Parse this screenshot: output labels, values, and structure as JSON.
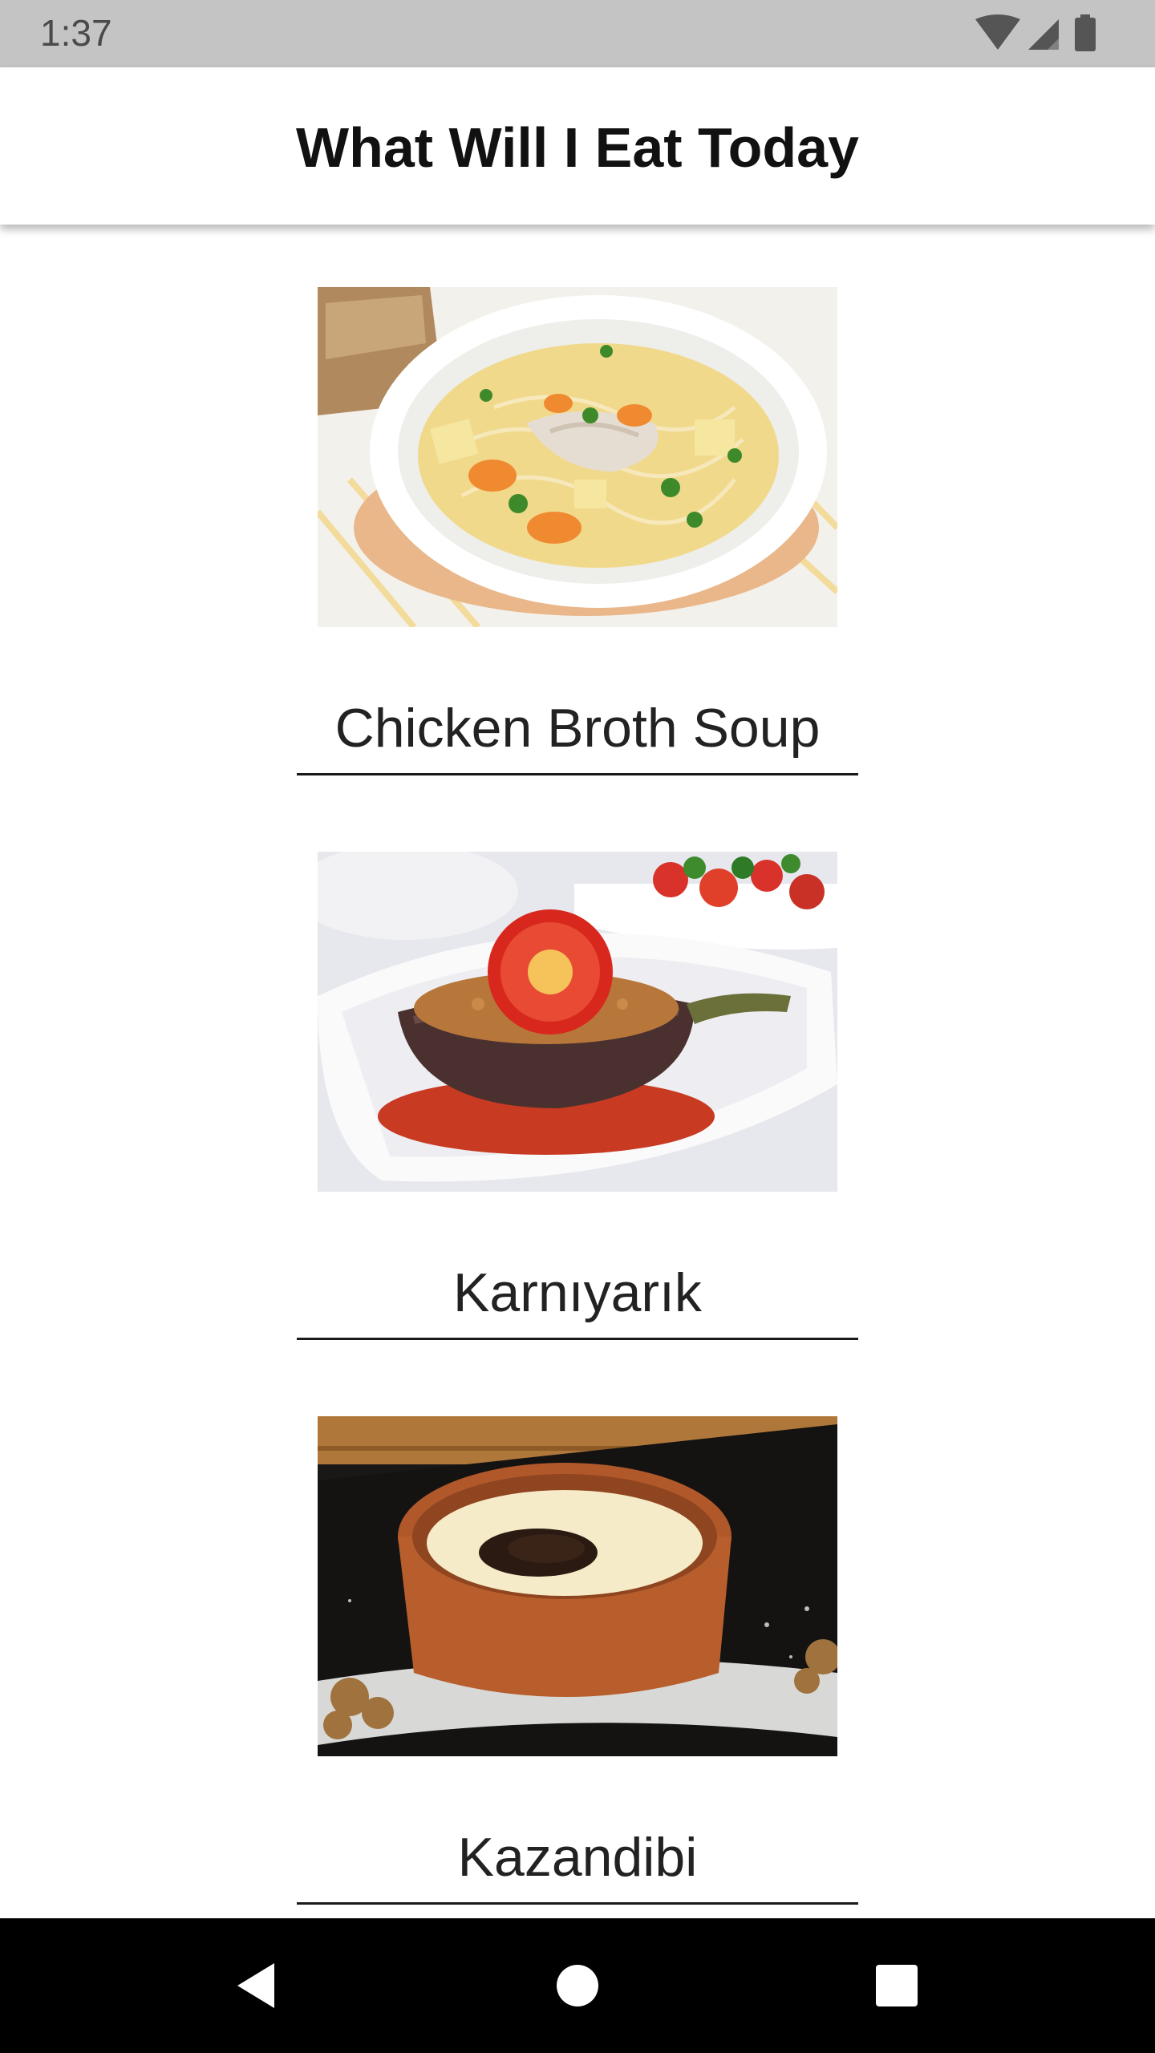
{
  "status_bar": {
    "time": "1:37",
    "icons": [
      "wifi-icon",
      "cell-signal-icon",
      "battery-icon"
    ]
  },
  "app_bar": {
    "title": "What Will I Eat Today"
  },
  "foods": [
    {
      "name": "Chicken Broth Soup",
      "image": "chicken-broth-soup-image"
    },
    {
      "name": "Karnıyarık",
      "image": "karniyarik-image"
    },
    {
      "name": "Kazandibi",
      "image": "kazandibi-image"
    }
  ],
  "nav_bar": {
    "buttons": [
      "back-icon",
      "home-icon",
      "recents-icon"
    ]
  },
  "colors": {
    "status_bar": "#c4c4c4",
    "app_bar": "#ffffff",
    "nav_bar": "#000000"
  }
}
